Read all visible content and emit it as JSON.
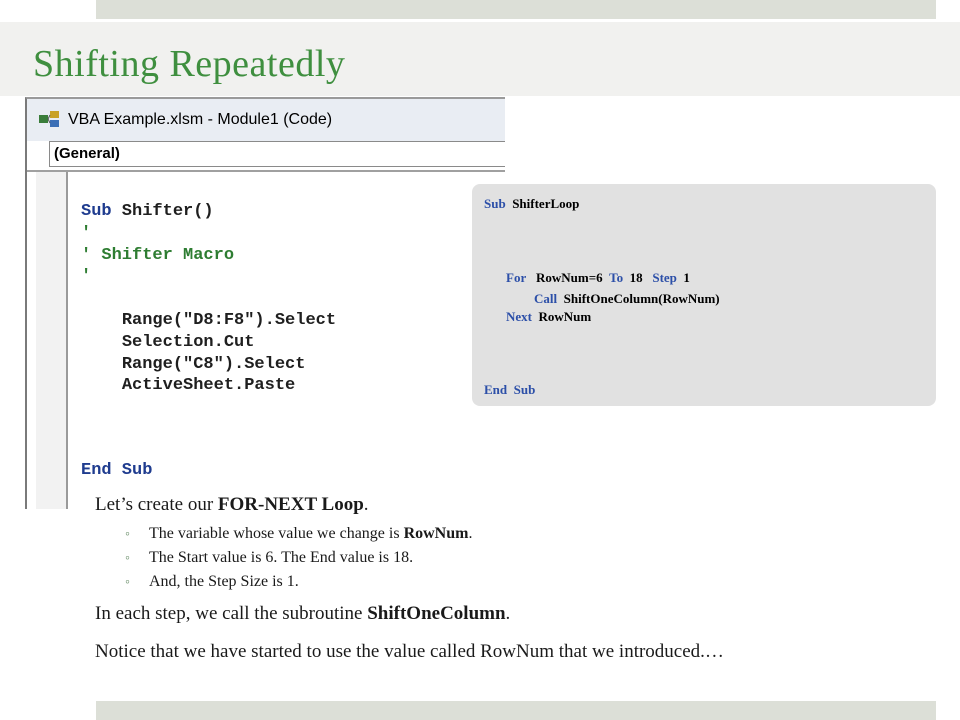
{
  "slide": {
    "title": "Shifting Repeatedly"
  },
  "vba_window": {
    "title": "VBA Example.xlsm - Module1 (Code)",
    "icon": "vba-project-icon",
    "combo_value": "(General)",
    "code_lines": {
      "sub_kw": "Sub",
      "sub_name": " Shifter()",
      "quote1": "'",
      "comment": "' Shifter Macro",
      "quote2": "'",
      "line1": "Range(\"D8:F8\").Select",
      "line2": "Selection.Cut",
      "line3": "Range(\"C8\").Select",
      "line4": "ActiveSheet.Paste",
      "end_sub": "End Sub"
    }
  },
  "code_panel": {
    "sub_kw": "Sub",
    "sub_name": "ShifterLoop",
    "for_kw": "For",
    "for_var": "RowNum=6",
    "to_kw": "To",
    "to_val": "18",
    "step_kw": "Step",
    "step_val": "1",
    "call_kw": "Call",
    "call_target": "ShiftOneColumn(RowNum)",
    "next_kw": "Next",
    "next_var": "RowNum",
    "end_kw": "End",
    "end_sub_kw": "Sub"
  },
  "body": {
    "p1_prefix": "Let’s create our ",
    "p1_bold": "FOR-NEXT  Loop",
    "p1_suffix": ".",
    "b1_prefix": "The variable whose value we change is ",
    "b1_bold": "RowNum",
    "b1_suffix": ".",
    "b2": "The Start value is 6. The End value is 18.",
    "b3": "And, the Step Size is 1.",
    "bullet_glyph": "◦",
    "p2_prefix": "In each step, we call the subroutine ",
    "p2_bold": "ShiftOneColumn",
    "p2_suffix": ".",
    "p3": "Notice that we have started to use the value called RowNum that we introduced.…"
  },
  "colors": {
    "title": "#3f8f3f",
    "keyword": "#2c4fa8",
    "comment": "#2e7d32",
    "panel_bg": "#e1e1e1",
    "bar": "#dcdfd7"
  }
}
